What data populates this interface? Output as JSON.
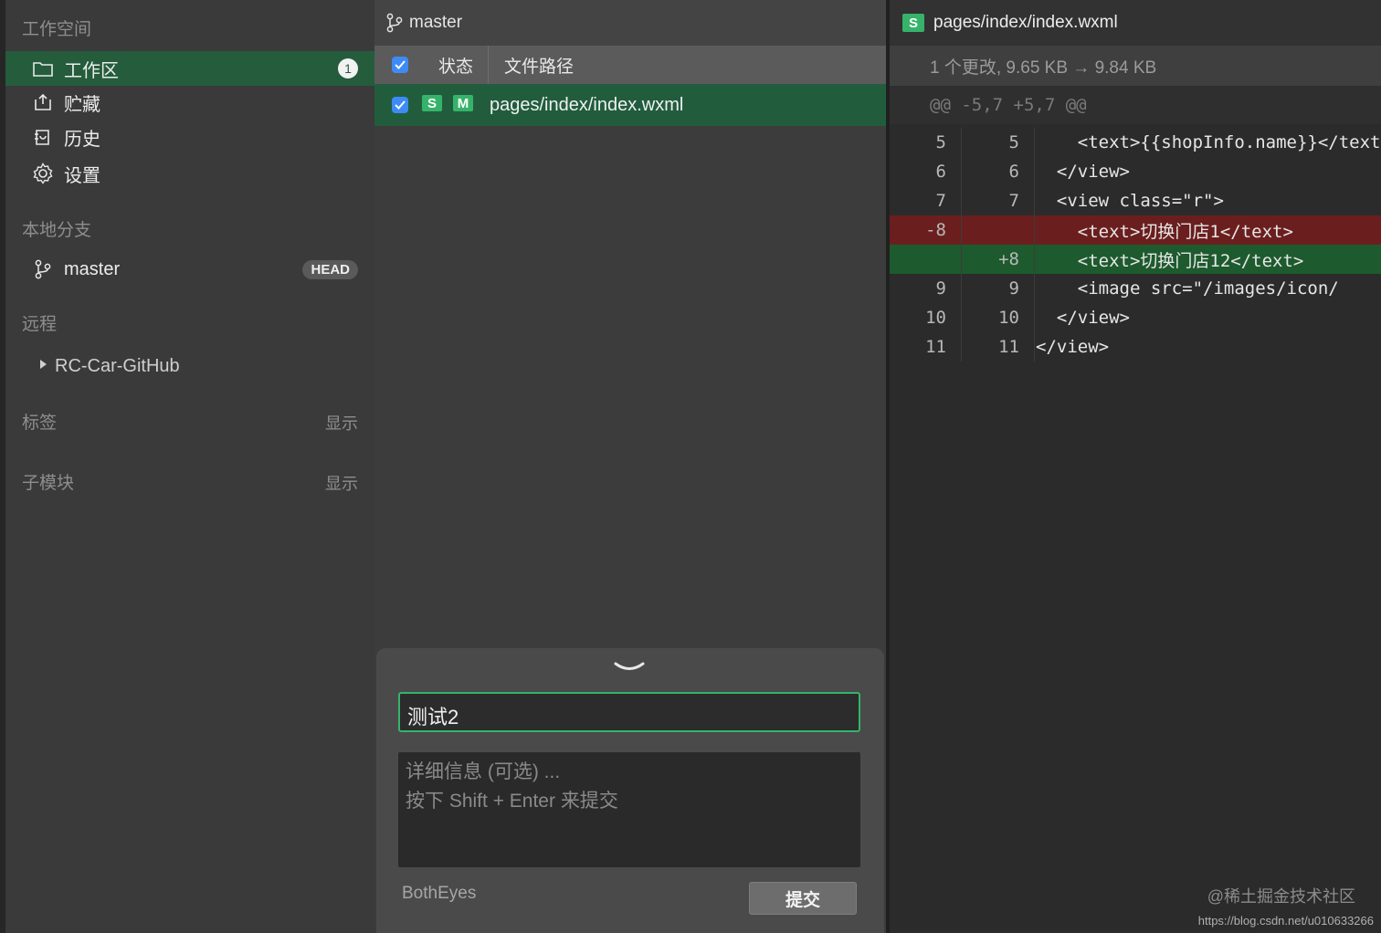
{
  "sidebar": {
    "workspace_title": "工作空间",
    "items": [
      {
        "label": "工作区",
        "count": "1"
      },
      {
        "label": "贮藏"
      },
      {
        "label": "历史"
      },
      {
        "label": "设置"
      }
    ],
    "local_branches_title": "本地分支",
    "branch": {
      "name": "master",
      "badge": "HEAD"
    },
    "remote_title": "远程",
    "remote_name": "RC-Car-GitHub",
    "tags_title": "标签",
    "tags_action": "显示",
    "submodules_title": "子模块",
    "submodules_action": "显示"
  },
  "middle": {
    "branch_name": "master",
    "header_status": "状态",
    "header_path": "文件路径",
    "file": {
      "tag1": "S",
      "tag2": "M",
      "path": "pages/index/index.wxml"
    },
    "commit": {
      "summary": "测试2",
      "detail_line1": "详细信息 (可选) ...",
      "detail_line2": "按下 Shift + Enter 来提交",
      "author": "BothEyes",
      "submit_label": "提交"
    }
  },
  "diff": {
    "tag": "S",
    "file_path": "pages/index/index.wxml",
    "info": "1 个更改, 9.65 KB → 9.84 KB",
    "hunk": "@@ -5,7 +5,7 @@",
    "lines": [
      {
        "old": "5",
        "new": "5",
        "code": "    <text>{{shopInfo.name}}</text>"
      },
      {
        "old": "6",
        "new": "6",
        "code": "  </view>"
      },
      {
        "old": "7",
        "new": "7",
        "code": "  <view class=\"r\">"
      },
      {
        "old": "-8",
        "new": "",
        "code": "    <text>切换门店1</text>"
      },
      {
        "old": "",
        "new": "+8",
        "code": "    <text>切换门店12</text>"
      },
      {
        "old": "9",
        "new": "9",
        "code": "    <image src=\"/images/icon/"
      },
      {
        "old": "10",
        "new": "10",
        "code": "  </view>"
      },
      {
        "old": "11",
        "new": "11",
        "code": "</view>"
      }
    ]
  },
  "watermark": "@稀土掘金技术社区",
  "url": "https://blog.csdn.net/u010633266",
  "colors": {
    "accent_green": "#36b36a",
    "selected_row": "#215d3d",
    "deleted_line": "#6b1e1e",
    "added_line": "#1d5a2e",
    "checkbox_blue": "#3d8bf5"
  }
}
